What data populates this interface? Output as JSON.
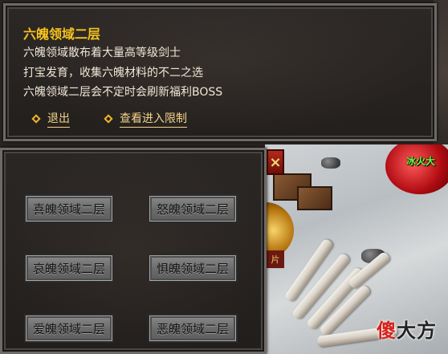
{
  "info": {
    "title": "六魄领域二层",
    "lines": [
      "六魄领域散布着大量高等级剑士",
      "打宝发育，收集六魄材料的不二之选",
      "六魄领域二层会不定时会刷新福利BOSS"
    ],
    "links": {
      "exit": "退出",
      "entry_limit": "查看进入限制"
    }
  },
  "menu": {
    "close_label": "×",
    "zones": [
      "喜魄领域二层",
      "怒魄领域二层",
      "哀魄领域二层",
      "惧魄领域二层",
      "爱魄领域二层",
      "恶魄领域二层"
    ]
  },
  "scene": {
    "monster_name": "冰火大",
    "item_tag": "片"
  },
  "watermark": {
    "part1": "傻",
    "part2": "大方"
  },
  "colors": {
    "title": "#f6c21d",
    "link": "#f3d38a",
    "close_button": "#b12a1b",
    "monster_name": "#66ff3a"
  }
}
